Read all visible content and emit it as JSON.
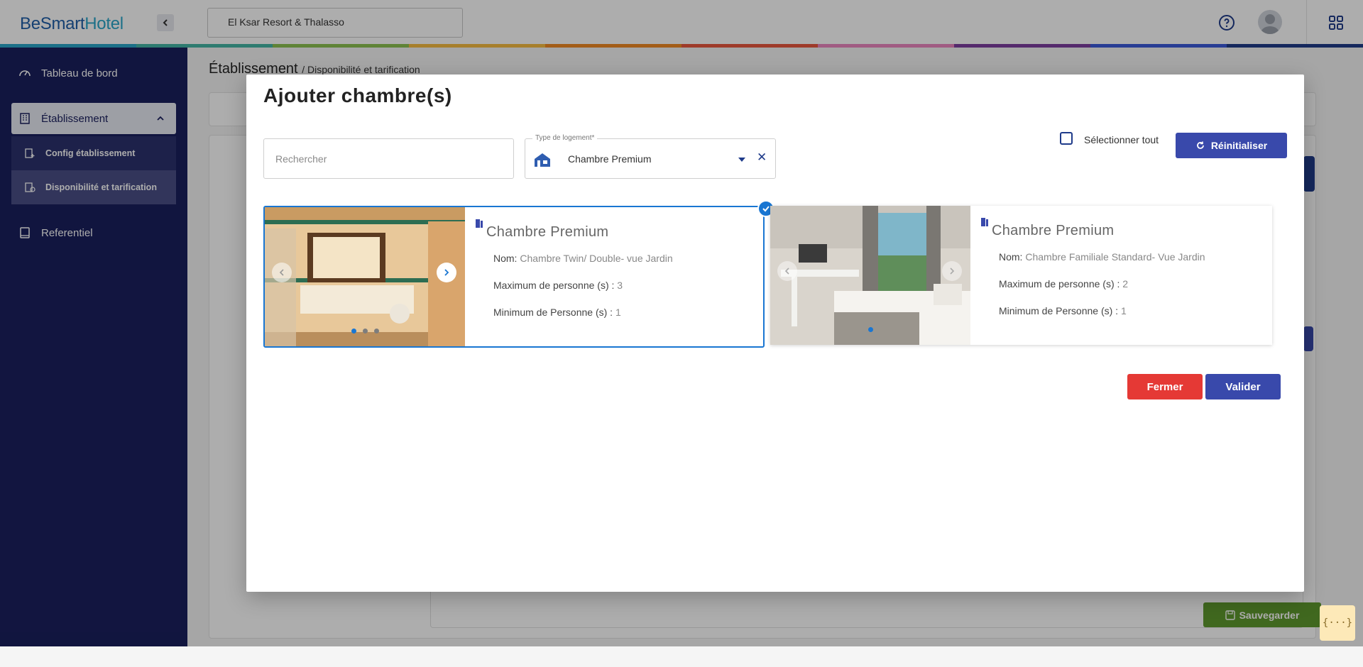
{
  "app": {
    "logo_part1": "BeSmart",
    "logo_part2": "Hotel"
  },
  "header": {
    "hotel_name": "El Ksar Resort & Thalasso"
  },
  "sidebar": {
    "dashboard": "Tableau de bord",
    "establishment": "Établissement",
    "config": "Config établissement",
    "availability": "Disponibilité et tarification",
    "referential": "Referentiel"
  },
  "page": {
    "title": "Établissement",
    "breadcrumb": "/ Disponibilité et tarification"
  },
  "dialog": {
    "title": "Ajouter chambre(s)",
    "search_placeholder": "Rechercher",
    "type_label": "Type de logement*",
    "type_value": "Chambre Premium",
    "select_all": "Sélectionner tout",
    "reset": "Réinitialiser",
    "close": "Fermer",
    "validate": "Valider"
  },
  "rooms": [
    {
      "title": "Chambre Premium",
      "name_label": "Nom:",
      "name": "Chambre Twin/ Double- vue Jardin",
      "max_label": "Maximum de personne (s) :",
      "max": "3",
      "min_label": "Minimum de Personne (s) :",
      "min": "1",
      "selected": true
    },
    {
      "title": "Chambre Premium",
      "name_label": "Nom:",
      "name": "Chambre Familiale Standard- Vue Jardin",
      "max_label": "Maximum de personne (s) :",
      "max": "2",
      "min_label": "Minimum de Personne (s) :",
      "min": "1",
      "selected": false
    }
  ],
  "footer_actions": {
    "save": "Sauvegarder",
    "json": "{···}"
  },
  "colors": {
    "sidebar": "#1a1f5e",
    "primary": "#3949ab",
    "danger": "#e53935",
    "selected": "#1976d2",
    "rainbow": [
      "#2aa6c9",
      "#45b5a5",
      "#8cc152",
      "#f6bb42",
      "#f08a24",
      "#e9573f",
      "#ec87c0",
      "#7e3fa0",
      "#3b5bdb",
      "#1f3b8a"
    ]
  }
}
